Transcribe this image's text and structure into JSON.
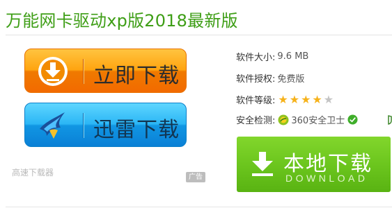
{
  "page": {
    "title": "万能网卡驱动xp版2018最新版"
  },
  "download_buttons": {
    "direct_label": "立即下载",
    "thunder_label": "迅雷下载",
    "fast_downloader_text": "高速下载器",
    "ad_badge": "广告"
  },
  "info": {
    "size_label": "软件大小:",
    "size_value": "9.6 MB",
    "license_label": "软件授权:",
    "license_value": "免费版",
    "level_label": "软件等级:",
    "rating": 4,
    "rating_max": 5,
    "security_label": "安全检测:",
    "security_value": "360安全卫士"
  },
  "local_download": {
    "label": "本地下载",
    "sublabel": "DOWNLOAD"
  },
  "colors": {
    "title_green": "#3e9e16",
    "orange_button": "#ffa410",
    "blue_button": "#1196e3",
    "green_button": "#6cc61e",
    "star_on": "#f6b21a",
    "star_off": "#c4c4c4"
  },
  "icons": {
    "direct": "download-arrow-circle-icon",
    "thunder": "thunder-bird-icon",
    "security": "360-security-icon",
    "verified": "check-circle-icon",
    "local": "download-arrow-icon"
  }
}
